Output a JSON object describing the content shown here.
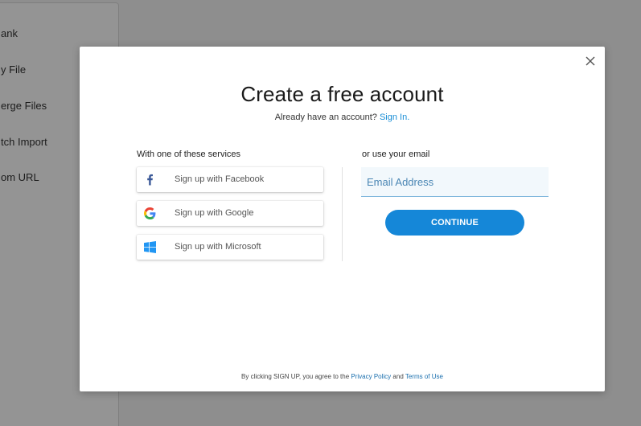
{
  "background": {
    "sidebar_items": [
      "ank",
      "y File",
      "erge Files",
      "tch Import",
      "om URL"
    ]
  },
  "modal": {
    "title": "Create a free account",
    "subtitle_text": "Already have an account?",
    "sign_in_link": "Sign In.",
    "close_icon": "close-icon",
    "services_label": "With one of these services",
    "email_label": "or use your email",
    "social_buttons": [
      {
        "label": "Sign up with Facebook",
        "icon": "facebook-icon",
        "color": "#3b5998"
      },
      {
        "label": "Sign up with Google",
        "icon": "google-icon"
      },
      {
        "label": "Sign up with Microsoft",
        "icon": "windows-icon",
        "color": "#2196f3"
      }
    ],
    "email_placeholder": "Email Address",
    "continue_label": "CONTINUE",
    "footer": {
      "text_before": "By clicking SIGN UP, you agree to the",
      "privacy_link": "Privacy Policy",
      "text_and": "and",
      "terms_link": "Terms of Use"
    },
    "accent_color": "#1587d8"
  }
}
